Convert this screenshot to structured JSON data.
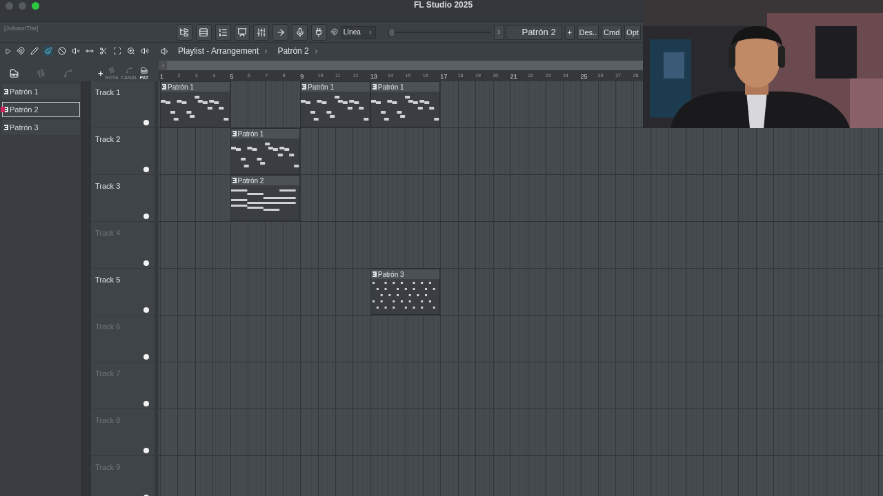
{
  "window": {
    "title": "FL Studio 2025"
  },
  "hint": "[JohannTite]",
  "snap": {
    "value": "Línea"
  },
  "pattern_selector": {
    "value": "Patrón 2",
    "add": "+"
  },
  "buttons": [
    "Des..",
    "Cmd",
    "Opt"
  ],
  "playlist": {
    "title": "Playlist - Arrangement",
    "breadcrumb": "Patrón 2",
    "tools": [
      {
        "kind": "play",
        "selected": false
      },
      {
        "kind": "magnet",
        "selected": false
      },
      {
        "kind": "pencil",
        "selected": false
      },
      {
        "kind": "brush",
        "selected": true
      },
      {
        "kind": "delete",
        "selected": false
      },
      {
        "kind": "mute",
        "selected": false
      },
      {
        "kind": "slip",
        "selected": false
      },
      {
        "kind": "slice",
        "selected": false
      },
      {
        "kind": "select",
        "selected": false
      },
      {
        "kind": "zoom",
        "selected": false
      },
      {
        "kind": "speaker",
        "selected": false
      }
    ]
  },
  "picker": {
    "add": "+",
    "columns": [
      "NOTA",
      "CANAL",
      "PAT"
    ],
    "patterns": [
      {
        "name": "Patrón 1",
        "selected": false
      },
      {
        "name": "Patrón 2",
        "selected": true
      },
      {
        "name": "Patrón 3",
        "selected": false
      }
    ]
  },
  "ruler": [
    "1",
    "2",
    "3",
    "4",
    "5",
    "6",
    "7",
    "8",
    "9",
    "10",
    "11",
    "12",
    "13",
    "14",
    "15",
    "16",
    "17",
    "18",
    "19",
    "20",
    "21",
    "22",
    "23",
    "24",
    "25",
    "26",
    "27",
    "28"
  ],
  "tracks": [
    {
      "name": "Track 1",
      "active": true,
      "slots": [
        {
          "kind": "steps",
          "label": "Patrón 1"
        },
        {
          "kind": "empty"
        },
        {
          "kind": "steps",
          "label": "Patrón 1"
        },
        {
          "kind": "steps",
          "label": "Patrón 1"
        }
      ]
    },
    {
      "name": "Track 2",
      "active": true,
      "slots": [
        {
          "kind": "empty"
        },
        {
          "kind": "steps",
          "label": "Patrón 1"
        }
      ]
    },
    {
      "name": "Track 3",
      "active": true,
      "slots": [
        {
          "kind": "empty"
        },
        {
          "kind": "chords",
          "label": "Patrón 2"
        }
      ]
    },
    {
      "name": "Track 4",
      "active": false
    },
    {
      "name": "Track 5",
      "active": true,
      "slots": [
        {
          "kind": "empty"
        },
        {
          "kind": "empty"
        },
        {
          "kind": "empty"
        },
        {
          "kind": "dense",
          "label": "Patrón 3"
        }
      ]
    },
    {
      "name": "Track 6",
      "active": false
    },
    {
      "name": "Track 7",
      "active": false
    },
    {
      "name": "Track 8",
      "active": false
    },
    {
      "name": "Track 9",
      "active": false
    }
  ],
  "webcam": {
    "kind": "picture"
  }
}
